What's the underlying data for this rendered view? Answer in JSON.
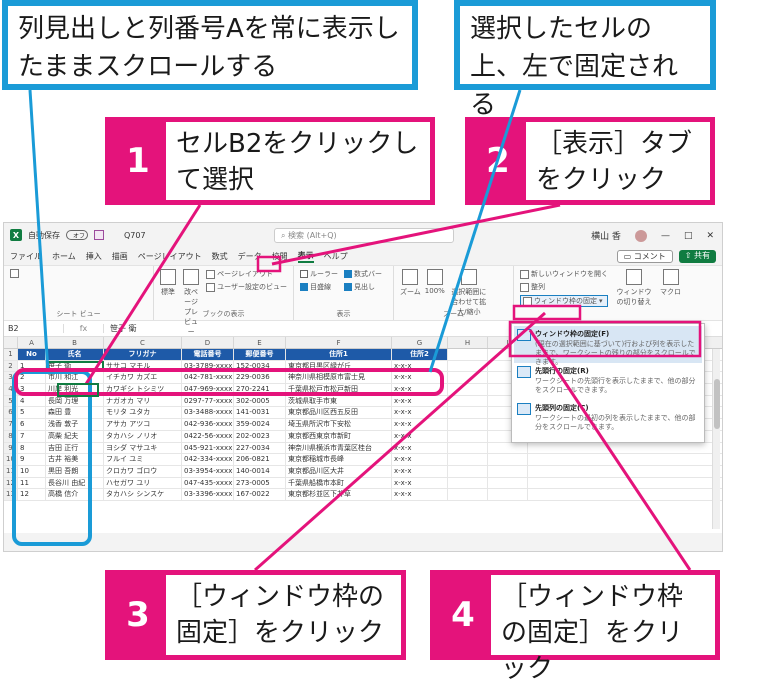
{
  "callouts": {
    "top_left": "列見出しと列番号Aを常に表示したままスクロールする",
    "top_right": "選択したセルの上、左で固定される"
  },
  "steps": [
    {
      "num": "1",
      "text": "セルB2をクリックして選択"
    },
    {
      "num": "2",
      "text": "［表示］タブをクリック"
    },
    {
      "num": "3",
      "text": "［ウィンドウ枠の固定］をクリック"
    },
    {
      "num": "4",
      "text": "［ウィンドウ枠の固定］をクリック"
    }
  ],
  "excel": {
    "autosave": "自動保存",
    "autosave_state": "オフ",
    "filename": "Q707",
    "search_placeholder": "検索 (Alt+Q)",
    "user": "横山 香",
    "menu": [
      "ファイル",
      "ホーム",
      "挿入",
      "描画",
      "ページレイアウト",
      "数式",
      "データ",
      "校閲",
      "表示",
      "ヘルプ"
    ],
    "active_tab": "表示",
    "comment_btn": "コメント",
    "share_btn": "共有",
    "ribbon": {
      "workbook_views": {
        "label": "ブックの表示",
        "normal": "標準",
        "page_break": "改ページプレビュー",
        "page_layout": "ページレイアウト",
        "custom": "ユーザー設定のビュー"
      },
      "sheet_view": {
        "label": "シート ビュー"
      },
      "show": {
        "label": "表示",
        "ruler": "ルーラー",
        "formula_bar": "数式バー",
        "gridlines": "目盛線",
        "headings": "見出し"
      },
      "zoom": {
        "label": "ズーム",
        "zoom": "ズーム",
        "hundred": "100%",
        "to_selection": "選択範囲に合わせて拡大/縮小"
      },
      "window": {
        "new_window": "新しいウィンドウを開く",
        "arrange": "整列",
        "freeze": "ウィンドウ枠の固定",
        "switch": "ウィンドウの切り替え",
        "macro": "マクロ"
      }
    },
    "name_box": "B2",
    "formula_content": "笹子 衛",
    "columns": [
      "A",
      "B",
      "C",
      "D",
      "E",
      "F",
      "G",
      "H",
      "I"
    ],
    "headers": [
      "No",
      "氏名",
      "フリガナ",
      "電話番号",
      "郵便番号",
      "住所1",
      "住所2"
    ],
    "rows": [
      [
        "1",
        "笹子 衛",
        "ササコ マモル",
        "03-3789-xxxx",
        "152-0034",
        "東京都目黒区緑が丘",
        "x-x-x"
      ],
      [
        "2",
        "市川 和江",
        "イチカワ カズエ",
        "042-781-xxxx",
        "229-0036",
        "神奈川県相模原市富士見",
        "x-x-x"
      ],
      [
        "3",
        "川岸 利光",
        "カワギシ トシミツ",
        "047-969-xxxx",
        "270-2241",
        "千葉県松戸市松戸新田",
        "x-x-x"
      ],
      [
        "4",
        "長岡 万理",
        "ナガオカ マリ",
        "0297-77-xxxx",
        "302-0005",
        "茨城県取手市東",
        "x-x-x"
      ],
      [
        "5",
        "森田 豊",
        "モリタ ユタカ",
        "03-3488-xxxx",
        "141-0031",
        "東京都品川区西五反田",
        "x-x-x"
      ],
      [
        "6",
        "浅香 敦子",
        "アサカ アツコ",
        "042-936-xxxx",
        "359-0024",
        "埼玉県所沢市下安松",
        "x-x-x"
      ],
      [
        "7",
        "高柴 紀夫",
        "タカハシ ノリオ",
        "0422-56-xxxx",
        "202-0023",
        "東京都西東京市新町",
        "x-x-x"
      ],
      [
        "8",
        "吉田 正行",
        "ヨシダ マサユキ",
        "045-921-xxxx",
        "227-0034",
        "神奈川県横浜市青葉区桂台",
        "x-x-x"
      ],
      [
        "9",
        "古井 裕美",
        "フルイ ユミ",
        "042-334-xxxx",
        "206-0821",
        "東京都稲城市長峰",
        "x-x-x"
      ],
      [
        "10",
        "黒田 吾朗",
        "クロカワ ゴロウ",
        "03-3954-xxxx",
        "140-0014",
        "東京都品川区大井",
        "x-x-x"
      ],
      [
        "11",
        "長谷川 由紀",
        "ハセガワ ユリ",
        "047-435-xxxx",
        "273-0005",
        "千葉県船橋市本町",
        "x-x-x"
      ],
      [
        "12",
        "高橋 信介",
        "タカハシ シンスケ",
        "03-3396-xxxx",
        "167-0022",
        "東京都杉並区下井草",
        "x-x-x"
      ]
    ],
    "dropdown": [
      {
        "title": "ウィンドウ枠の固定(F)",
        "desc": "(現在の選択範囲に基づいて)行および列を表示したままで、ワークシートの残りの部分をスクロールできます。"
      },
      {
        "title": "先頭行の固定(R)",
        "desc": "ワークシートの先頭行を表示したままで、他の部分をスクロールできます。"
      },
      {
        "title": "先頭列の固定(C)",
        "desc": "ワークシートの最初の列を表示したままで、他の部分をスクロールできます。"
      }
    ]
  },
  "colors": {
    "callout_blue": "#1a9bd7",
    "step_pink": "#e4137b",
    "excel_green": "#107c41",
    "header_blue": "#1e5aa8"
  }
}
